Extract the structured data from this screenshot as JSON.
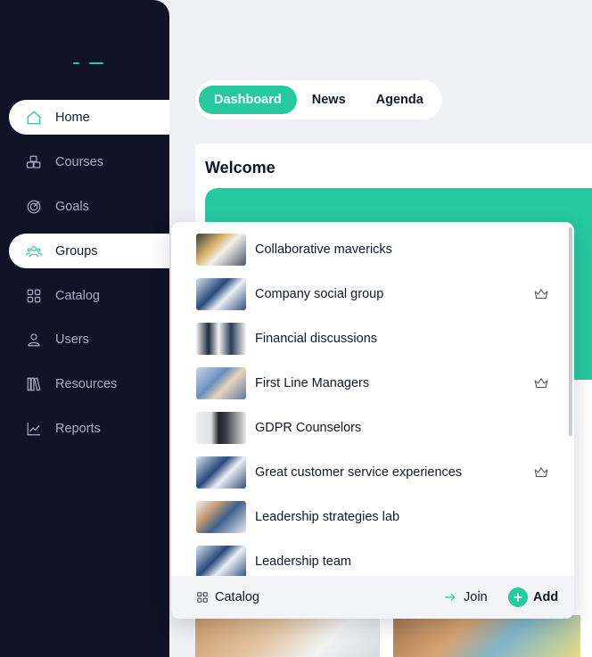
{
  "sidebar": {
    "items": [
      {
        "label": "Home",
        "icon": "home-icon"
      },
      {
        "label": "Courses",
        "icon": "cubes-icon"
      },
      {
        "label": "Goals",
        "icon": "target-icon"
      },
      {
        "label": "Groups",
        "icon": "users-icon"
      },
      {
        "label": "Catalog",
        "icon": "grid-icon"
      },
      {
        "label": "Users",
        "icon": "user-icon"
      },
      {
        "label": "Resources",
        "icon": "library-icon"
      },
      {
        "label": "Reports",
        "icon": "chart-line-icon"
      }
    ]
  },
  "tabs": [
    {
      "label": "Dashboard"
    },
    {
      "label": "News"
    },
    {
      "label": "Agenda"
    }
  ],
  "main": {
    "welcome_title": "Welcome"
  },
  "groups_menu": {
    "items": [
      {
        "name": "Collaborative mavericks",
        "crown": false
      },
      {
        "name": "Company social group",
        "crown": true
      },
      {
        "name": "Financial discussions",
        "crown": false
      },
      {
        "name": "First Line Managers",
        "crown": true
      },
      {
        "name": "GDPR Counselors",
        "crown": false
      },
      {
        "name": "Great customer service experiences",
        "crown": true
      },
      {
        "name": "Leadership strategies lab",
        "crown": false
      },
      {
        "name": "Leadership team",
        "crown": false
      }
    ],
    "footer": {
      "catalog_label": "Catalog",
      "join_label": "Join",
      "add_label": "Add"
    }
  },
  "colors": {
    "accent": "#27c9a0",
    "sidebar_bg": "#0e1426",
    "page_bg": "#eef0f5"
  }
}
